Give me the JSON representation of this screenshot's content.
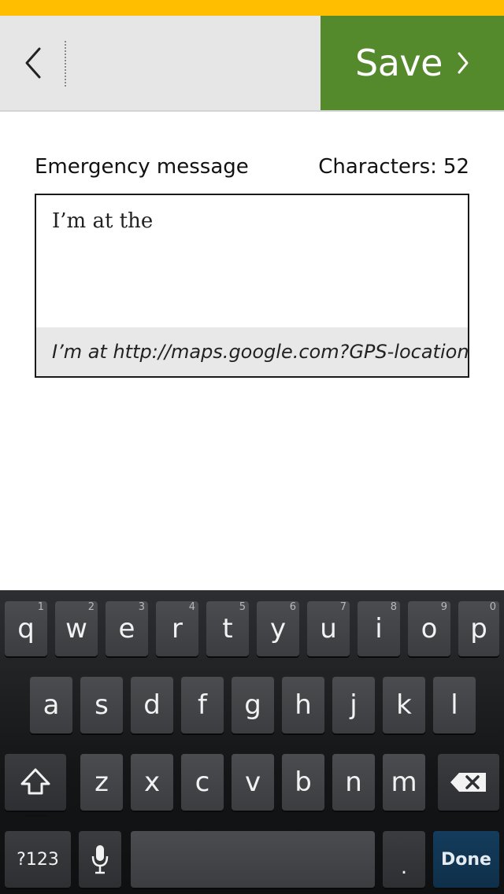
{
  "header": {
    "back_label": "",
    "save_label": "Save"
  },
  "form": {
    "label": "Emergency message",
    "char_count_label": "Characters:",
    "char_count_value": "52",
    "message_value": "I’m at the",
    "preview": "I’m at http://maps.google.com?GPS-location"
  },
  "keyboard": {
    "row1": [
      {
        "char": "q",
        "hint": "1"
      },
      {
        "char": "w",
        "hint": "2"
      },
      {
        "char": "e",
        "hint": "3"
      },
      {
        "char": "r",
        "hint": "4"
      },
      {
        "char": "t",
        "hint": "5"
      },
      {
        "char": "y",
        "hint": "6"
      },
      {
        "char": "u",
        "hint": "7"
      },
      {
        "char": "i",
        "hint": "8"
      },
      {
        "char": "o",
        "hint": "9"
      },
      {
        "char": "p",
        "hint": "0"
      }
    ],
    "row2": [
      "a",
      "s",
      "d",
      "f",
      "g",
      "h",
      "j",
      "k",
      "l"
    ],
    "row3": [
      "z",
      "x",
      "c",
      "v",
      "b",
      "n",
      "m"
    ],
    "symbols_label": "?123",
    "period_label": ".",
    "done_label": "Done",
    "icons": {
      "shift": "shift-icon",
      "backspace": "backspace-icon",
      "mic": "microphone-icon"
    }
  },
  "colors": {
    "status_bar": "#ffbf00",
    "save_button": "#54892c",
    "done_key": "#143c5c"
  }
}
